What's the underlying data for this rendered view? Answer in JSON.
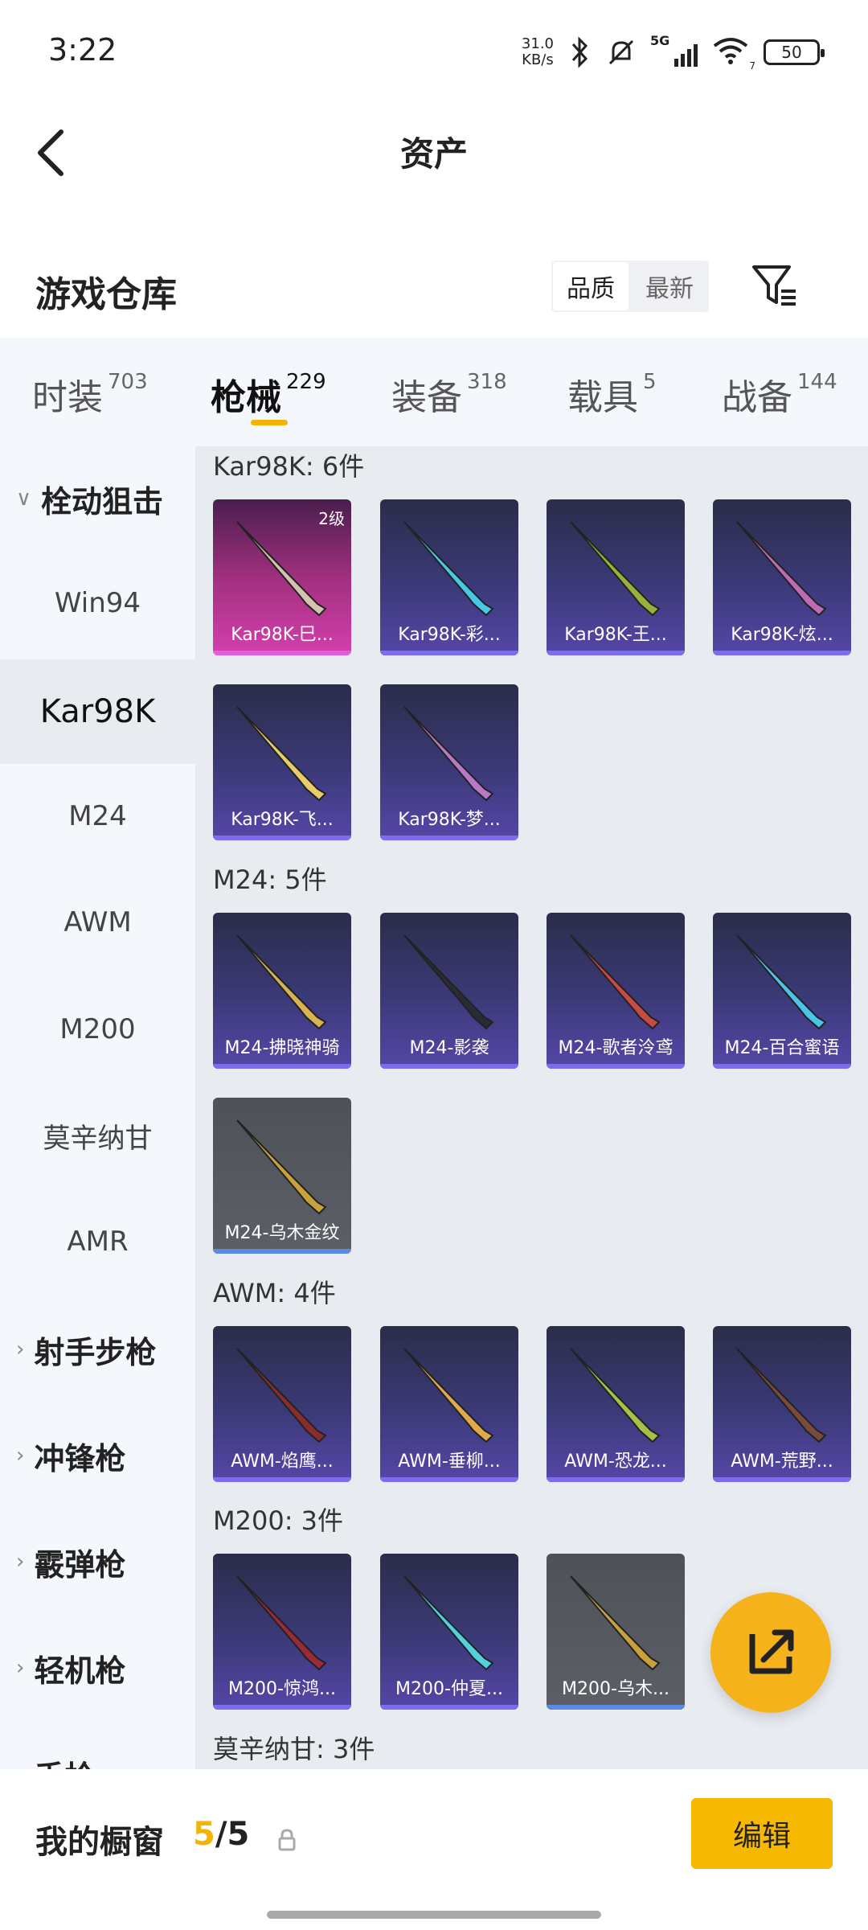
{
  "status_bar": {
    "time": "3:22",
    "net_speed_value": "31.0",
    "net_speed_unit": "KB/s",
    "network": "5G",
    "wifi_sub": "7",
    "battery": "50"
  },
  "header": {
    "title": "资产"
  },
  "warehouse": {
    "title": "游戏仓库",
    "sort_quality": "品质",
    "sort_newest": "最新"
  },
  "tabs": [
    {
      "label": "时装",
      "count": "703"
    },
    {
      "label": "枪械",
      "count": "229"
    },
    {
      "label": "装备",
      "count": "318"
    },
    {
      "label": "载具",
      "count": "5"
    },
    {
      "label": "战备",
      "count": "144"
    }
  ],
  "sidebar": {
    "group_bolt": "栓动狙击",
    "items": [
      "Win94",
      "Kar98K",
      "M24",
      "AWM",
      "M200",
      "莫辛纳甘",
      "AMR"
    ],
    "group_marksman": "射手步枪",
    "group_smg": "冲锋枪",
    "group_shotgun": "霰弹枪",
    "group_lmg": "轻机枪",
    "group_pistol": "手枪"
  },
  "sections": [
    {
      "title": "Kar98K: 6件",
      "items": [
        {
          "name": "Kar98K-巳...",
          "level": "2级",
          "style": "pink",
          "color": "#d6c2b0"
        },
        {
          "name": "Kar98K-彩...",
          "style": "purple",
          "color": "#47c8e6"
        },
        {
          "name": "Kar98K-王...",
          "style": "purple",
          "color": "#9bb03a"
        },
        {
          "name": "Kar98K-炫...",
          "style": "purple",
          "color": "#c06ab5"
        },
        {
          "name": "Kar98K-飞...",
          "style": "purple",
          "color": "#e6cd6a"
        },
        {
          "name": "Kar98K-梦...",
          "style": "purple",
          "color": "#b778c8"
        }
      ]
    },
    {
      "title": "M24: 5件",
      "items": [
        {
          "name": "M24-拂晓神骑",
          "style": "purple",
          "color": "#d8b350"
        },
        {
          "name": "M24-影袭",
          "style": "purple",
          "color": "#2b2b35"
        },
        {
          "name": "M24-歌者泠鸢",
          "style": "purple",
          "color": "#c84a44"
        },
        {
          "name": "M24-百合蜜语",
          "style": "purple",
          "color": "#4cc4ea"
        },
        {
          "name": "M24-乌木金纹",
          "style": "gray",
          "color": "#c9a13a"
        }
      ]
    },
    {
      "title": "AWM: 4件",
      "items": [
        {
          "name": "AWM-焰鹰...",
          "style": "purple",
          "color": "#8a2c2c"
        },
        {
          "name": "AWM-垂柳...",
          "style": "purple",
          "color": "#e2a94a"
        },
        {
          "name": "AWM-恐龙...",
          "style": "purple",
          "color": "#a6c04a"
        },
        {
          "name": "AWM-荒野...",
          "style": "purple",
          "color": "#7a4a3a"
        }
      ]
    },
    {
      "title": "M200: 3件",
      "items": [
        {
          "name": "M200-惊鸿...",
          "style": "purple",
          "color": "#9a2a3a"
        },
        {
          "name": "M200-仲夏...",
          "style": "purple",
          "color": "#52d0e0"
        },
        {
          "name": "M200-乌木...",
          "style": "gray",
          "color": "#c9a13a"
        }
      ]
    },
    {
      "title": "莫辛纳甘: 3件",
      "items": []
    }
  ],
  "bottom": {
    "window_label": "我的橱窗",
    "window_current": "5",
    "window_total": "/5",
    "edit_label": "编辑"
  },
  "colors": {
    "accent": "#f4b400",
    "content_bg": "#e8ecf1",
    "sidebar_bg": "#f4f7fb"
  }
}
